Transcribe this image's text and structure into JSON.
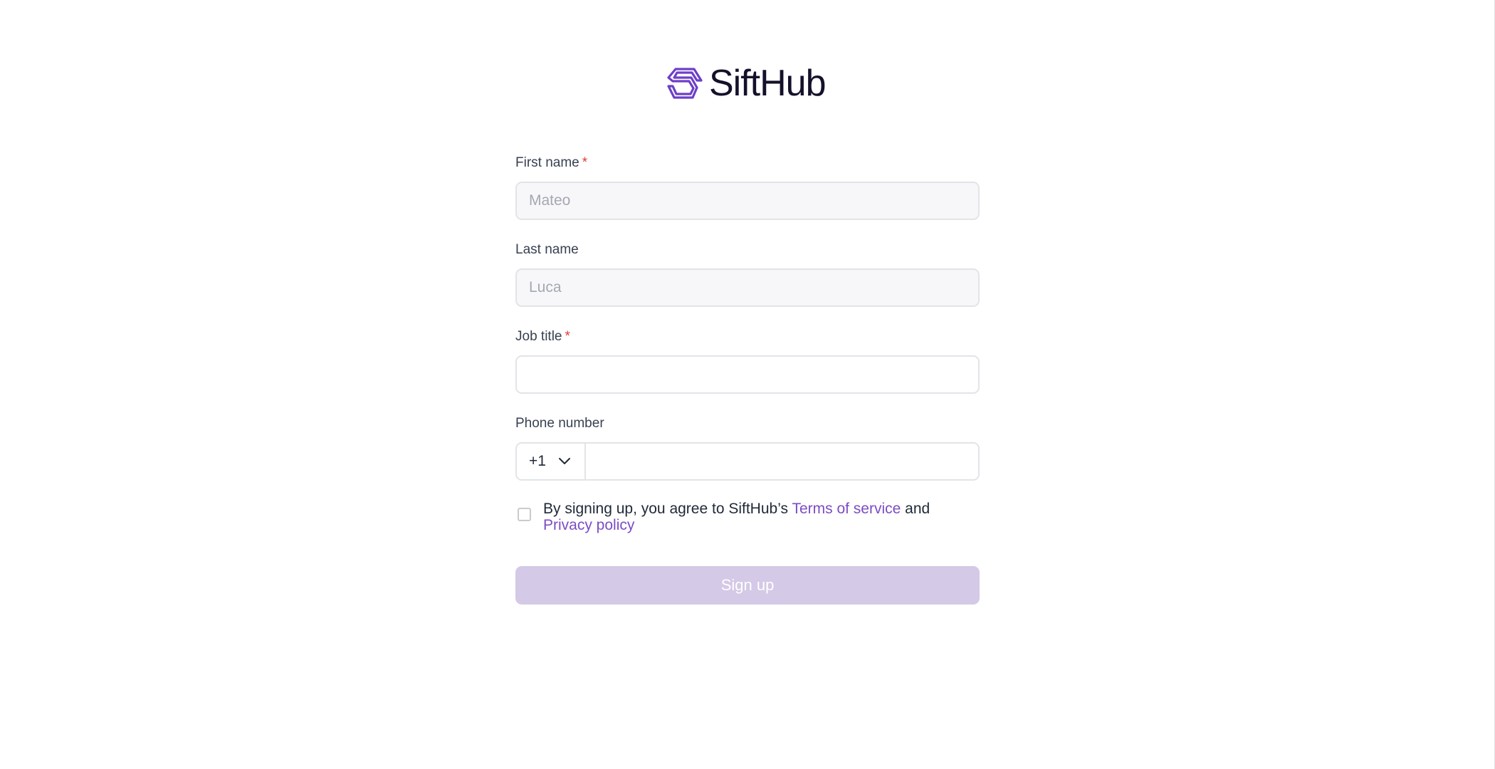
{
  "brand": {
    "name": "SiftHub",
    "accent": "#6d3fc8"
  },
  "form": {
    "first_name": {
      "label": "First name",
      "required_mark": "*",
      "placeholder": "Mateo"
    },
    "last_name": {
      "label": "Last name",
      "placeholder": "Luca"
    },
    "job_title": {
      "label": "Job title",
      "required_mark": "*",
      "value": ""
    },
    "phone": {
      "label": "Phone number",
      "country_code": "+1",
      "value": ""
    },
    "terms": {
      "prefix": "By signing up, you agree to SiftHub’s ",
      "tos_link": "Terms of service",
      "middle": " and ",
      "privacy_link": "Privacy policy"
    },
    "submit_label": "Sign up"
  },
  "colors": {
    "required": "#e53935",
    "link": "#7c4cc4",
    "submit_disabled": "#d4c9e6"
  }
}
